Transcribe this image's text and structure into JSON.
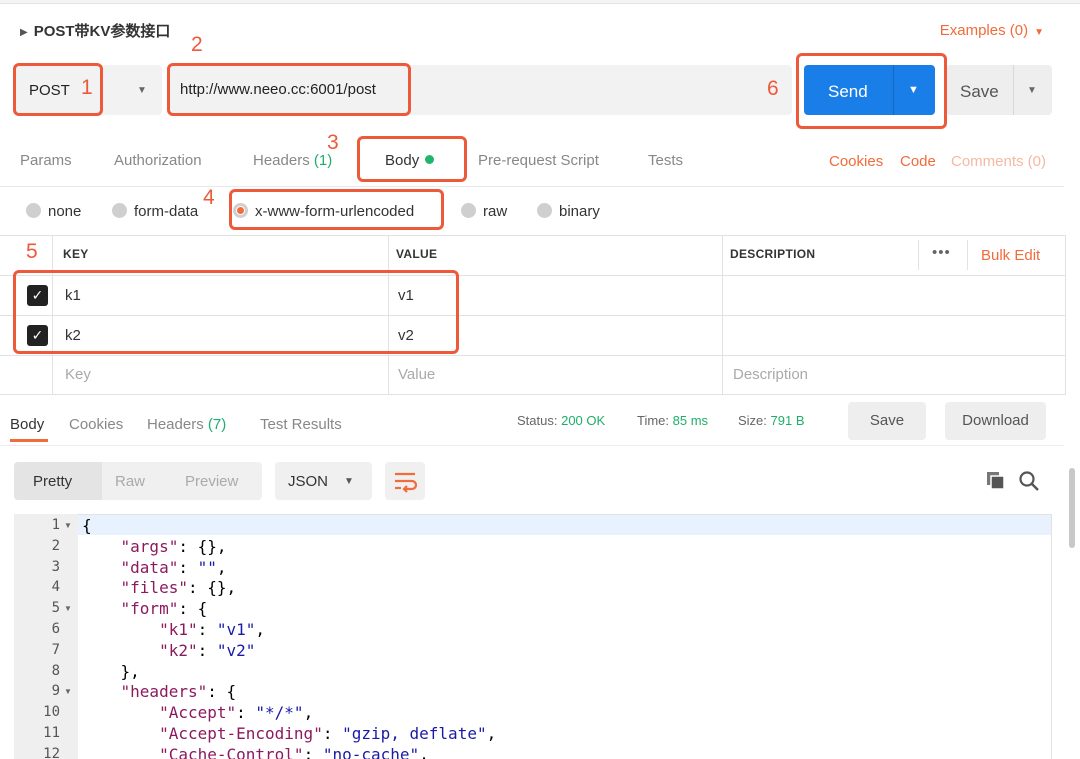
{
  "request": {
    "title": "POST带KV参数接口",
    "examples": "Examples (0)",
    "method": "POST",
    "url": "http://www.neeo.cc:6001/post",
    "send_label": "Send",
    "save_label": "Save"
  },
  "request_tabs": {
    "params": "Params",
    "authorization": "Authorization",
    "headers": "Headers",
    "headers_count": "(1)",
    "body": "Body",
    "prerequest": "Pre-request Script",
    "tests": "Tests",
    "cookies": "Cookies",
    "code": "Code",
    "comments": "Comments (0)"
  },
  "body_modes": [
    "none",
    "form-data",
    "x-www-form-urlencoded",
    "raw",
    "binary"
  ],
  "kv_table": {
    "headers": [
      "KEY",
      "VALUE",
      "DESCRIPTION"
    ],
    "bulk_edit": "Bulk Edit",
    "more": "•••",
    "rows": [
      {
        "key": "k1",
        "value": "v1"
      },
      {
        "key": "k2",
        "value": "v2"
      }
    ],
    "placeholders": {
      "key": "Key",
      "value": "Value",
      "description": "Description"
    }
  },
  "response": {
    "tabs": {
      "body": "Body",
      "cookies": "Cookies",
      "headers": "Headers",
      "headers_count": "(7)",
      "test_results": "Test Results"
    },
    "status_label": "Status:",
    "status_value": "200 OK",
    "time_label": "Time:",
    "time_value": "85 ms",
    "size_label": "Size:",
    "size_value": "791 B",
    "save_label": "Save",
    "download_label": "Download",
    "views": [
      "Pretty",
      "Raw",
      "Preview"
    ],
    "format": "JSON"
  },
  "code_lines": [
    {
      "n": "1",
      "text": "{"
    },
    {
      "n": "2",
      "text": "    \"args\": {},"
    },
    {
      "n": "3",
      "text": "    \"data\": \"\","
    },
    {
      "n": "4",
      "text": "    \"files\": {},"
    },
    {
      "n": "5",
      "text": "    \"form\": {"
    },
    {
      "n": "6",
      "text": "        \"k1\": \"v1\","
    },
    {
      "n": "7",
      "text": "        \"k2\": \"v2\""
    },
    {
      "n": "8",
      "text": "    },"
    },
    {
      "n": "9",
      "text": "    \"headers\": {"
    },
    {
      "n": "10",
      "text": "        \"Accept\": \"*/*\","
    },
    {
      "n": "11",
      "text": "        \"Accept-Encoding\": \"gzip, deflate\","
    },
    {
      "n": "12",
      "text": "        \"Cache-Control\": \"no-cache\","
    }
  ],
  "annotations": [
    "1",
    "2",
    "3",
    "4",
    "5",
    "6"
  ],
  "colors": {
    "accent": "#f26b3a",
    "annotation": "#ec5a3a",
    "send": "#1a7ee8",
    "success": "#1fae6a",
    "json_key": "#8b1a5e",
    "json_string": "#1a1aa6"
  },
  "icons": [
    "caret-right-icon",
    "chevron-down-icon",
    "check-icon",
    "wrap-icon",
    "copy-icon",
    "search-icon"
  ]
}
